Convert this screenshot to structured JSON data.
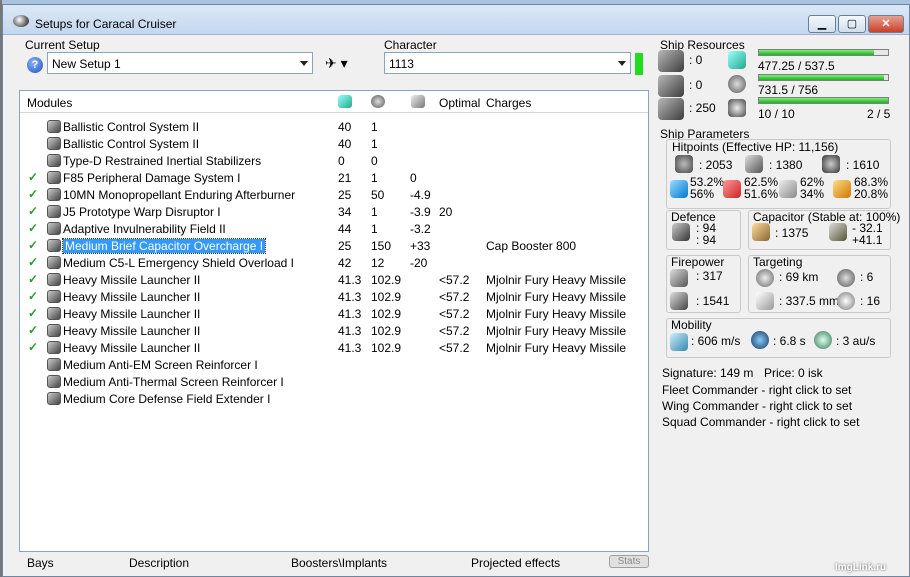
{
  "window": {
    "title": "Setups for Caracal Cruiser"
  },
  "setup": {
    "current_setup_label": "Current Setup",
    "current_setup_value": "New Setup 1",
    "character_label": "Character",
    "character_value": "1113"
  },
  "modules": {
    "headers": {
      "modules": "Modules",
      "optimal": "Optimal",
      "charges": "Charges"
    },
    "rows": [
      {
        "checked": false,
        "name": "Ballistic Control System II",
        "cpu": "40",
        "power": "1",
        "cap": "",
        "optimal": "",
        "charges": "",
        "selected": false,
        "icon": "ballistic-control-icon"
      },
      {
        "checked": false,
        "name": "Ballistic Control System II",
        "cpu": "40",
        "power": "1",
        "cap": "",
        "optimal": "",
        "charges": "",
        "selected": false,
        "icon": "ballistic-control-icon"
      },
      {
        "checked": false,
        "name": "Type-D Restrained Inertial Stabilizers",
        "cpu": "0",
        "power": "0",
        "cap": "",
        "optimal": "",
        "charges": "",
        "selected": false,
        "icon": "inertial-stabilizer-icon"
      },
      {
        "checked": true,
        "name": "F85 Peripheral Damage System I",
        "cpu": "21",
        "power": "1",
        "cap": "0",
        "optimal": "",
        "charges": "",
        "selected": false,
        "icon": "damage-system-icon"
      },
      {
        "checked": true,
        "name": "10MN Monopropellant Enduring Afterburner",
        "cpu": "25",
        "power": "50",
        "cap": "-4.9",
        "optimal": "",
        "charges": "",
        "selected": false,
        "icon": "afterburner-icon"
      },
      {
        "checked": true,
        "name": "J5 Prototype Warp Disruptor I",
        "cpu": "34",
        "power": "1",
        "cap": "-3.9",
        "optimal": "20",
        "charges": "",
        "selected": false,
        "icon": "warp-disruptor-icon"
      },
      {
        "checked": true,
        "name": "Adaptive Invulnerability Field II",
        "cpu": "44",
        "power": "1",
        "cap": "-3.2",
        "optimal": "",
        "charges": "",
        "selected": false,
        "icon": "invulnerability-field-icon"
      },
      {
        "checked": true,
        "name": "Medium Brief Capacitor Overcharge I",
        "cpu": "25",
        "power": "150",
        "cap": "+33",
        "optimal": "",
        "charges": "Cap Booster 800",
        "selected": true,
        "icon": "capacitor-booster-icon"
      },
      {
        "checked": true,
        "name": "Medium C5-L Emergency Shield Overload I",
        "cpu": "42",
        "power": "12",
        "cap": "-20",
        "optimal": "",
        "charges": "",
        "selected": false,
        "icon": "shield-booster-icon"
      },
      {
        "checked": true,
        "name": "Heavy Missile Launcher II",
        "cpu": "41.3",
        "power": "102.9",
        "cap": "",
        "optimal": "<57.2",
        "charges": "Mjolnir Fury Heavy Missile",
        "selected": false,
        "icon": "missile-launcher-icon"
      },
      {
        "checked": true,
        "name": "Heavy Missile Launcher II",
        "cpu": "41.3",
        "power": "102.9",
        "cap": "",
        "optimal": "<57.2",
        "charges": "Mjolnir Fury Heavy Missile",
        "selected": false,
        "icon": "missile-launcher-icon"
      },
      {
        "checked": true,
        "name": "Heavy Missile Launcher II",
        "cpu": "41.3",
        "power": "102.9",
        "cap": "",
        "optimal": "<57.2",
        "charges": "Mjolnir Fury Heavy Missile",
        "selected": false,
        "icon": "missile-launcher-icon"
      },
      {
        "checked": true,
        "name": "Heavy Missile Launcher II",
        "cpu": "41.3",
        "power": "102.9",
        "cap": "",
        "optimal": "<57.2",
        "charges": "Mjolnir Fury Heavy Missile",
        "selected": false,
        "icon": "missile-launcher-icon"
      },
      {
        "checked": true,
        "name": "Heavy Missile Launcher II",
        "cpu": "41.3",
        "power": "102.9",
        "cap": "",
        "optimal": "<57.2",
        "charges": "Mjolnir Fury Heavy Missile",
        "selected": false,
        "icon": "missile-launcher-icon"
      },
      {
        "checked": false,
        "name": "Medium Anti-EM Screen Reinforcer I",
        "cpu": "",
        "power": "",
        "cap": "",
        "optimal": "",
        "charges": "",
        "selected": false,
        "icon": "rig-icon"
      },
      {
        "checked": false,
        "name": "Medium Anti-Thermal Screen Reinforcer I",
        "cpu": "",
        "power": "",
        "cap": "",
        "optimal": "",
        "charges": "",
        "selected": false,
        "icon": "rig-icon"
      },
      {
        "checked": false,
        "name": "Medium Core Defense Field Extender I",
        "cpu": "",
        "power": "",
        "cap": "",
        "optimal": "",
        "charges": "",
        "selected": false,
        "icon": "rig-icon"
      }
    ]
  },
  "tabs": {
    "bays": "Bays",
    "description": "Description",
    "boosters": "Boosters\\Implants",
    "projected": "Projected effects",
    "stats": "Stats"
  },
  "resources": {
    "title": "Ship Resources",
    "turret_slots": ": 0",
    "launcher_slots": ": 0",
    "calibration": ": 250",
    "cpu": "477.25 / 537.5",
    "cpu_fraction": 0.888,
    "power": "731.5 / 756",
    "power_fraction": 0.968,
    "drone_bw": "10 / 10",
    "drone_bw_fraction": 1.0,
    "drones": "2 / 5"
  },
  "parameters": {
    "title": "Ship Parameters",
    "hitpoints": "Hitpoints (Effective HP: 11,156)",
    "hp_shield": ": 2053",
    "hp_armor": ": 1380",
    "hp_structure": ": 1610",
    "res_1_top": "53.2%",
    "res_1_bot": "56%",
    "res_2_top": "62.5%",
    "res_2_bot": "51.6%",
    "res_3_top": "62%",
    "res_3_bot": "34%",
    "res_4_top": "68.3%",
    "res_4_bot": "20.8%",
    "defence_title": "Defence",
    "defence_1": ": 94",
    "defence_2": ": 94",
    "capacitor_title": "Capacitor (Stable at: 100%)",
    "cap_amount": ": 1375",
    "cap_1": "- 32.1",
    "cap_2": "+41.1",
    "firepower_title": "Firepower",
    "fp_1": ": 317",
    "fp_2": ": 1541",
    "targeting_title": "Targeting",
    "tg_range": ": 69 km",
    "tg_targets": ": 6",
    "tg_scan": ": 337.5 mm",
    "tg_sensor": ": 16",
    "mobility_title": "Mobility",
    "mob_speed": ": 606 m/s",
    "mob_align": ": 6.8 s",
    "mob_warp": ": 3 au/s",
    "signature": "Signature: 149 m",
    "price": "Price: 0 isk",
    "fleet": "Fleet Commander - right click to set",
    "wing": "Wing Commander - right click to set",
    "squad": "Squad Commander - right click to set"
  },
  "watermark": "ImgLink.ru"
}
